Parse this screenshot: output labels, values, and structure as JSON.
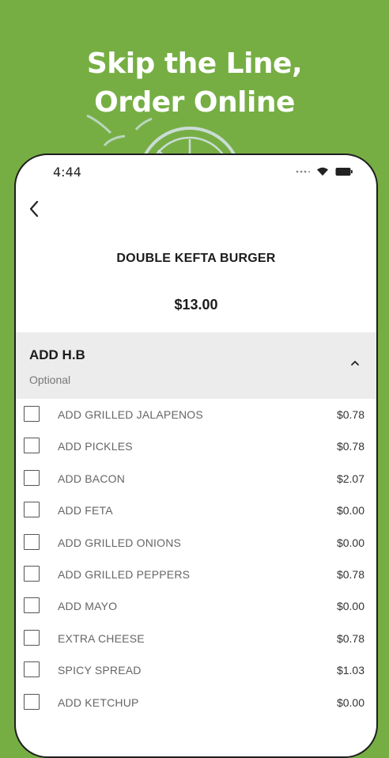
{
  "promo": {
    "headline_line1": "Skip the Line,",
    "headline_line2": "Order Online"
  },
  "status_bar": {
    "time": "4:44",
    "icons": [
      "signal-dots-icon",
      "wifi-icon",
      "battery-icon"
    ]
  },
  "navigation": {
    "back_icon": "chevron-left-icon"
  },
  "product": {
    "name": "DOUBLE KEFTA BURGER",
    "price": "$13.00"
  },
  "modifier_group": {
    "title": "ADD H.B",
    "subtitle": "Optional",
    "toggle_icon": "chevron-up-icon",
    "options": [
      {
        "label": "ADD GRILLED JALAPENOS",
        "price": "$0.78"
      },
      {
        "label": "ADD PICKLES",
        "price": "$0.78"
      },
      {
        "label": "ADD BACON",
        "price": "$2.07"
      },
      {
        "label": "ADD FETA",
        "price": "$0.00"
      },
      {
        "label": "ADD GRILLED ONIONS",
        "price": "$0.00"
      },
      {
        "label": "ADD GRILLED PEPPERS",
        "price": "$0.78"
      },
      {
        "label": "ADD MAYO",
        "price": "$0.00"
      },
      {
        "label": "EXTRA CHEESE",
        "price": "$0.78"
      },
      {
        "label": "SPICY SPREAD",
        "price": "$1.03"
      },
      {
        "label": "ADD KETCHUP",
        "price": "$0.00"
      }
    ]
  },
  "colors": {
    "background": "#76ae44",
    "section_header": "#ececec",
    "watermark": "#dde6ee"
  }
}
